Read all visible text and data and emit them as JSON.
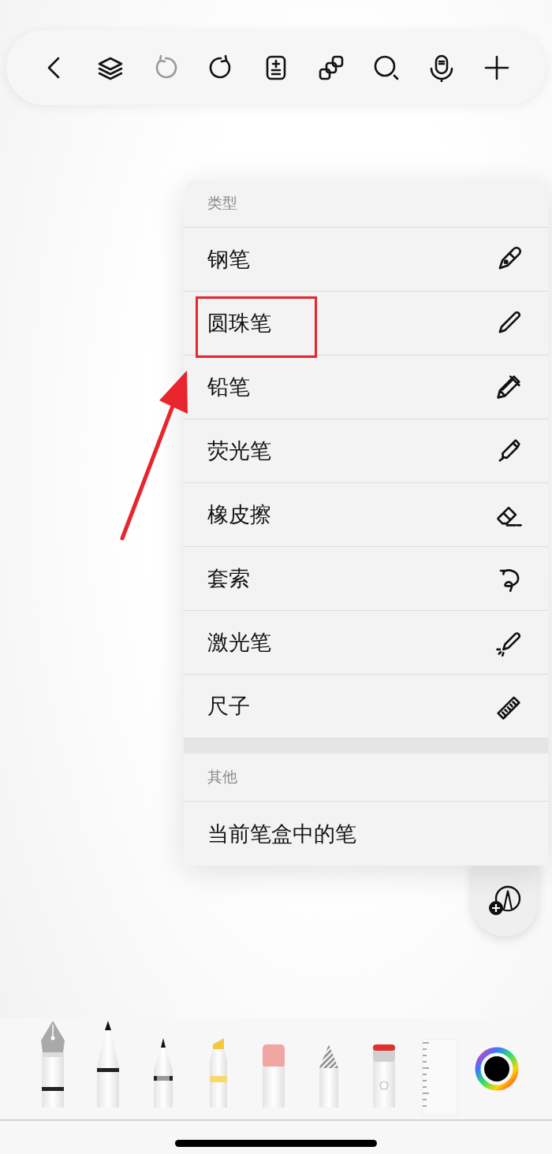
{
  "toolbar": [
    {
      "kind": "back",
      "disabled": false
    },
    {
      "kind": "layers",
      "disabled": false
    },
    {
      "kind": "undo",
      "disabled": true
    },
    {
      "kind": "redo",
      "disabled": false
    },
    {
      "kind": "page",
      "disabled": false
    },
    {
      "kind": "copy",
      "disabled": false
    },
    {
      "kind": "search",
      "disabled": false
    },
    {
      "kind": "mic",
      "disabled": false
    },
    {
      "kind": "add",
      "disabled": false
    }
  ],
  "menu": {
    "sections": [
      {
        "title": "类型",
        "items": [
          {
            "label": "钢笔",
            "kind": "fountain",
            "highlighted": false
          },
          {
            "label": "圆珠笔",
            "kind": "ballpoint",
            "highlighted": true
          },
          {
            "label": "铅笔",
            "kind": "pencil",
            "highlighted": false
          },
          {
            "label": "荧光笔",
            "kind": "highlighter",
            "highlighted": false
          },
          {
            "label": "橡皮擦",
            "kind": "eraser",
            "highlighted": false
          },
          {
            "label": "套索",
            "kind": "lasso",
            "highlighted": false
          },
          {
            "label": "激光笔",
            "kind": "laser",
            "highlighted": false
          },
          {
            "label": "尺子",
            "kind": "ruler",
            "highlighted": false
          }
        ]
      },
      {
        "title": "其他",
        "items": [
          {
            "label": "当前笔盒中的笔",
            "kind": "none",
            "highlighted": false
          }
        ]
      }
    ]
  },
  "tray": [
    {
      "kind": "fountain"
    },
    {
      "kind": "marker"
    },
    {
      "kind": "pencil"
    },
    {
      "kind": "highlighter"
    },
    {
      "kind": "eraser"
    },
    {
      "kind": "lasso"
    },
    {
      "kind": "laser"
    },
    {
      "kind": "ruler"
    },
    {
      "kind": "color"
    }
  ]
}
